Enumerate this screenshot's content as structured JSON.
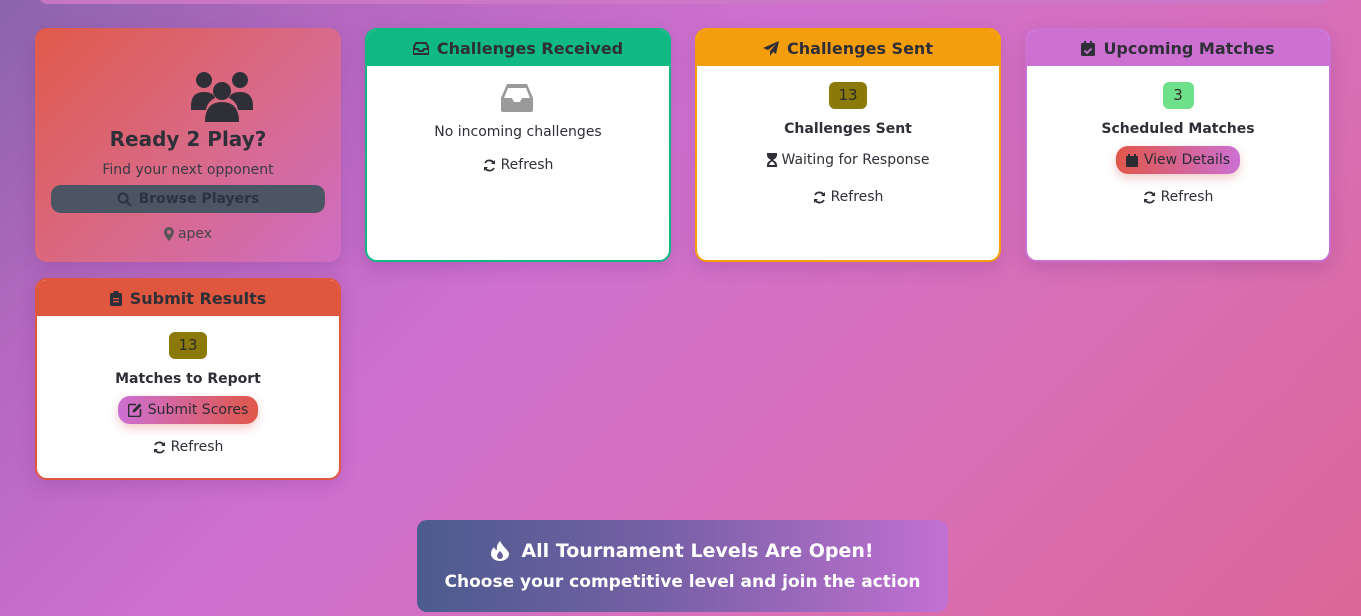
{
  "welcome": {
    "title": "Ready 2 Play?",
    "subtitle": "Find your next opponent",
    "browse_label": "Browse Players",
    "location": "apex",
    "icons": [
      "users-icon",
      "search-icon",
      "map-marker-icon"
    ]
  },
  "challenges_received": {
    "header": "Challenges Received",
    "empty_text": "No incoming challenges",
    "refresh_label": "Refresh",
    "color": "#10b981",
    "icons": [
      "inbox-icon",
      "refresh-icon"
    ]
  },
  "challenges_sent": {
    "header": "Challenges Sent",
    "count": "13",
    "label": "Challenges Sent",
    "status": "Waiting for Response",
    "refresh_label": "Refresh",
    "color": "#f59e0b",
    "badge_color": "#8b7a0a",
    "icons": [
      "paper-plane-icon",
      "hourglass-icon",
      "refresh-icon"
    ]
  },
  "upcoming_matches": {
    "header": "Upcoming Matches",
    "count": "3",
    "label": "Scheduled Matches",
    "details_label": "View Details",
    "refresh_label": "Refresh",
    "color": "#cc70d2",
    "badge_color": "#6ee08a",
    "icons": [
      "calendar-check-icon",
      "calendar-icon",
      "refresh-icon"
    ]
  },
  "submit_results": {
    "header": "Submit Results",
    "count": "13",
    "label": "Matches to Report",
    "submit_label": "Submit Scores",
    "refresh_label": "Refresh",
    "color": "#e0573f",
    "badge_color": "#8b7a0a",
    "icons": [
      "clipboard-icon",
      "edit-icon",
      "refresh-icon"
    ]
  },
  "banner": {
    "title": "All Tournament Levels Are Open!",
    "subtitle": "Choose your competitive level and join the action",
    "icon": "fire-icon"
  }
}
